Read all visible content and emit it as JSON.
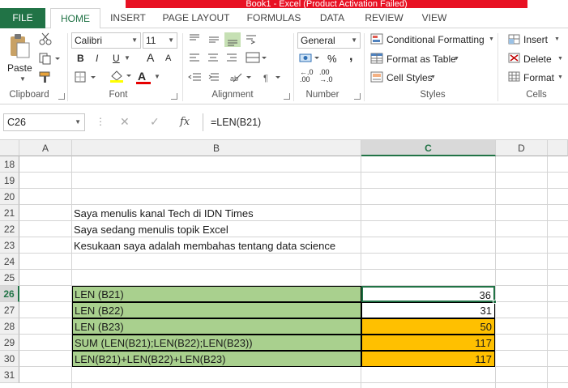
{
  "title_bar": {
    "text": "Book1 - Excel (Product Activation Failed)"
  },
  "ribbon_tabs": [
    "FILE",
    "HOME",
    "INSERT",
    "PAGE LAYOUT",
    "FORMULAS",
    "DATA",
    "REVIEW",
    "VIEW"
  ],
  "clipboard": {
    "paste_label": "Paste",
    "group_label": "Clipboard"
  },
  "font": {
    "name": "Calibri",
    "size": "11",
    "bold": "B",
    "italic": "I",
    "underline": "U",
    "grow": "A",
    "shrink": "A",
    "font_color_letter": "A",
    "group_label": "Font"
  },
  "alignment": {
    "group_label": "Alignment"
  },
  "number": {
    "format": "General",
    "percent": "%",
    "comma": ",",
    "inc_decimal": ".00",
    "dec_decimal": ".00",
    "inc_decimal_sub": "←.0",
    "dec_decimal_sub": "→.0",
    "group_label": "Number"
  },
  "styles": {
    "conditional": "Conditional Formatting",
    "format_table": "Format as Table",
    "cell_styles": "Cell Styles",
    "group_label": "Styles"
  },
  "cells_group": {
    "insert": "Insert",
    "delete": "Delete",
    "format": "Format",
    "group_label": "Cells"
  },
  "formula_bar": {
    "name_box": "C26",
    "cancel": "✕",
    "enter": "✓",
    "fx": "fx",
    "formula": "=LEN(B21)"
  },
  "columns": [
    "A",
    "B",
    "C",
    "D"
  ],
  "rows": [
    "18",
    "19",
    "20",
    "21",
    "22",
    "23",
    "24",
    "25",
    "26",
    "27",
    "28",
    "29",
    "30",
    "31"
  ],
  "cells": {
    "b21": "Saya menulis kanal Tech di IDN Times",
    "b22": "Saya sedang menulis topik Excel",
    "b23": "Kesukaan saya adalah membahas tentang data science",
    "b26": "LEN (B21)",
    "b27": "LEN (B22)",
    "b28": "LEN (B23)",
    "b29": "SUM (LEN(B21);LEN(B22);LEN(B23))",
    "b30": "LEN(B21)+LEN(B22)+LEN(B23)",
    "c26": "36",
    "c27": "31",
    "c28": "50",
    "c29": "117",
    "c30": "117"
  },
  "colors": {
    "accent": "#217346",
    "green_fill": "#a9d08e",
    "orange_fill": "#ffc000"
  }
}
